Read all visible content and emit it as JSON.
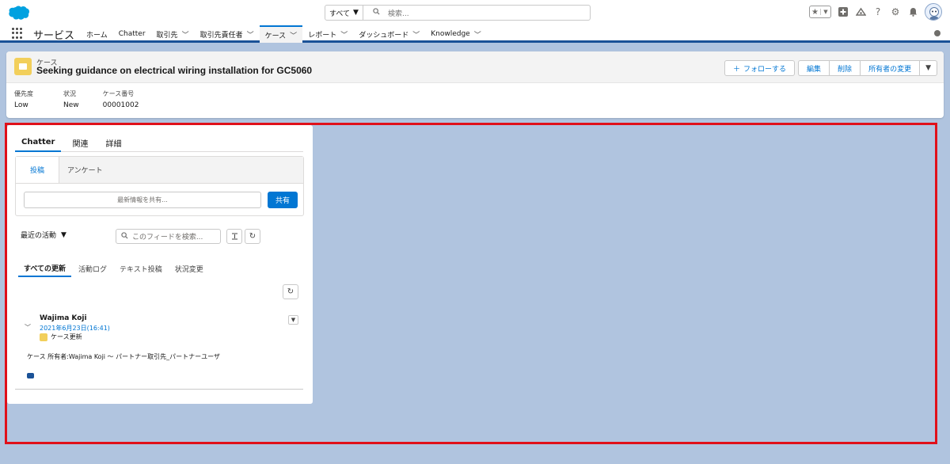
{
  "header": {
    "search_scope": "すべて",
    "search_placeholder": "検索...",
    "icons": [
      "favorites-star-icon",
      "add-icon",
      "help-trailhead-icon",
      "help-icon",
      "setup-gear-icon",
      "notifications-bell-icon",
      "avatar"
    ]
  },
  "nav": {
    "app_name": "サービス",
    "items": [
      {
        "label": "ホーム",
        "dropdown": false
      },
      {
        "label": "Chatter",
        "dropdown": false
      },
      {
        "label": "取引先",
        "dropdown": true
      },
      {
        "label": "取引先責任者",
        "dropdown": true
      },
      {
        "label": "ケース",
        "dropdown": true,
        "active": true
      },
      {
        "label": "レポート",
        "dropdown": true
      },
      {
        "label": "ダッシュボード",
        "dropdown": true
      },
      {
        "label": "Knowledge",
        "dropdown": true
      }
    ]
  },
  "record": {
    "object_type": "ケース",
    "title": "Seeking guidance on electrical wiring installation for GC5060",
    "actions": {
      "follow": "フォローする",
      "edit": "編集",
      "delete": "削除",
      "change_owner": "所有者の変更"
    },
    "highlights": [
      {
        "label": "優先度",
        "value": "Low"
      },
      {
        "label": "状況",
        "value": "New"
      },
      {
        "label": "ケース番号",
        "value": "00001002"
      }
    ]
  },
  "feed": {
    "tabs": [
      "Chatter",
      "関連",
      "詳細"
    ],
    "publisher_tabs": [
      "投稿",
      "アンケート"
    ],
    "share_placeholder": "最新情報を共有...",
    "share_button": "共有",
    "sort_label": "最近の活動",
    "search_placeholder": "このフィードを検索...",
    "filter_tabs": [
      "すべての更新",
      "活動ログ",
      "テキスト投稿",
      "状況変更"
    ],
    "post": {
      "author": "Wajima Koji",
      "timestamp": "2021年6月23日(16:41)",
      "type": "ケース更新",
      "body": "ケース 所有者:Wajima Koji ～ パートナー取引先_パートナーユーザ"
    }
  },
  "colors": {
    "brand_blue": "#0176d3",
    "nav_border": "#1b5297",
    "background": "#b0c4df",
    "case_icon": "#f2cf5b",
    "highlight_frame": "#e0101a"
  }
}
